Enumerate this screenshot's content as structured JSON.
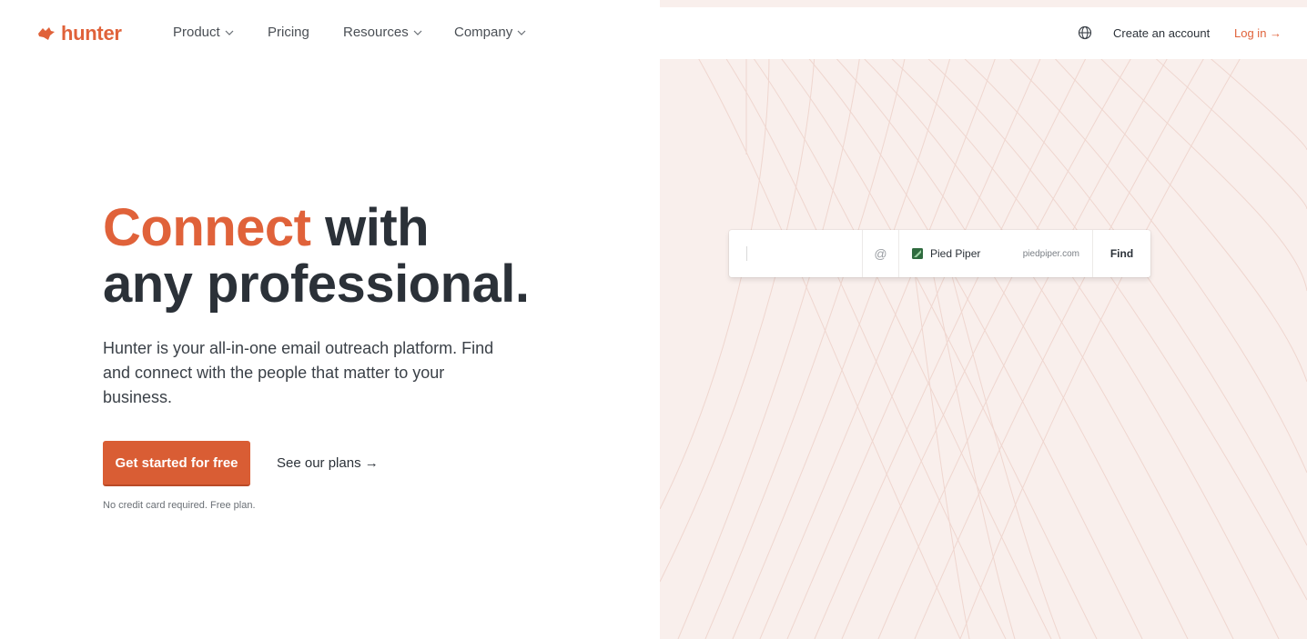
{
  "brand": {
    "name": "hunter",
    "accent": "#e0623a",
    "panel_bg": "#f9efec"
  },
  "nav": {
    "product": "Product",
    "pricing": "Pricing",
    "resources": "Resources",
    "company": "Company"
  },
  "header_right": {
    "globe_icon": "globe-icon",
    "create_account": "Create an account",
    "login": "Log in →"
  },
  "hero": {
    "headline_accent": "Connect",
    "headline_rest_1": " with",
    "headline_line_2": "any professional.",
    "subtext": "Hunter is your all-in-one email outreach platform. Find and connect with the people that matter to your business.",
    "cta_primary": "Get started for free",
    "cta_secondary": "See our plans →",
    "fineprint": "No credit card required. Free plan."
  },
  "search_card": {
    "name_value": "",
    "at_symbol": "@",
    "company_name": "Pied Piper",
    "company_domain": "piedpiper.com",
    "find_label": "Find"
  }
}
